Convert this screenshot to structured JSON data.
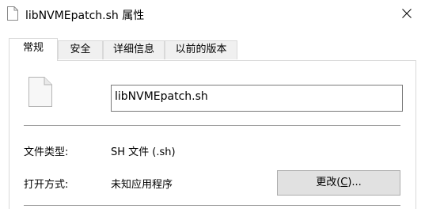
{
  "window": {
    "title": "libNVMEpatch.sh 属性"
  },
  "tabs": [
    {
      "label": "常规"
    },
    {
      "label": "安全"
    },
    {
      "label": "详细信息"
    },
    {
      "label": "以前的版本"
    }
  ],
  "general": {
    "filename_value": "libNVMEpatch.sh",
    "filetype_label": "文件类型:",
    "filetype_value": "SH 文件 (.sh)",
    "openwith_label": "打开方式:",
    "openwith_value": "未知应用程序",
    "change_button": {
      "text_before": "更改(",
      "mnemonic": "C",
      "text_after": ")..."
    }
  }
}
